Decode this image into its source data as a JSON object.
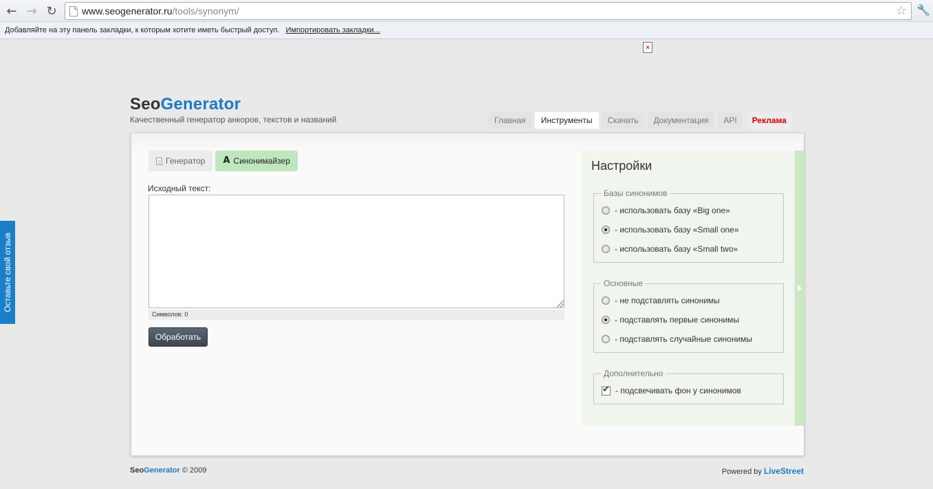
{
  "browser": {
    "url_host": "www.seogenerator.ru",
    "url_path": "/tools/synonym/",
    "bookmarks_prompt": "Добавляйте на эту панель закладки, к которым хотите иметь быстрый доступ.",
    "bookmarks_import": "Импортировать закладки..."
  },
  "feedback": {
    "label": "Оставьте свой отзыв"
  },
  "header": {
    "logo_part1": "Seo",
    "logo_part2": "Generator",
    "tagline": "Качественный генератор анкоров, текстов и названий"
  },
  "menu": [
    {
      "label": "Главная"
    },
    {
      "label": "Инструменты"
    },
    {
      "label": "Скачать"
    },
    {
      "label": "Документация"
    },
    {
      "label": "API"
    },
    {
      "label": "Реклама"
    }
  ],
  "tabs": [
    {
      "label": "Генератор"
    },
    {
      "label": "Синонимайзер"
    }
  ],
  "form": {
    "source_label": "Исходный текст:",
    "source_value": "",
    "counter_label": "Символов:",
    "counter_value": "0",
    "submit_label": "Обработать"
  },
  "settings": {
    "title": "Настройки",
    "groups": [
      {
        "legend": "Базы синонимов",
        "options": [
          {
            "label": "- использовать базу «Big one»",
            "checked": false
          },
          {
            "label": "- использовать базу «Small one»",
            "checked": true
          },
          {
            "label": "- использовать базу «Small two»",
            "checked": false
          }
        ]
      },
      {
        "legend": "Основные",
        "options": [
          {
            "label": "- не подставлять синонимы",
            "checked": false
          },
          {
            "label": "- подставлять первые синонимы",
            "checked": true
          },
          {
            "label": "- подставлять случайные синонимы",
            "checked": false
          }
        ]
      },
      {
        "legend": "Дополнительно",
        "options": [
          {
            "label": "- подсвечивать фон у синонимов",
            "checked": true
          }
        ]
      }
    ]
  },
  "footer": {
    "logo_part1": "Seo",
    "logo_part2": "Generator",
    "copyright": "© 2009",
    "powered_by": "Powered by",
    "powered_brand": "LiveStreet"
  },
  "colors": {
    "brand_blue": "#1a7cc0",
    "active_tab_green": "#bfe6bd",
    "ad_red": "#d60000",
    "feedback_blue": "#1b7fc8"
  },
  "icons": {
    "back": "back-arrow-icon",
    "forward": "forward-arrow-icon",
    "reload": "reload-icon",
    "bookmark_star": "star-icon",
    "wrench": "wrench-icon",
    "generator_tab": "document-icon",
    "synonymizer_tab": "letter-a-icon"
  }
}
